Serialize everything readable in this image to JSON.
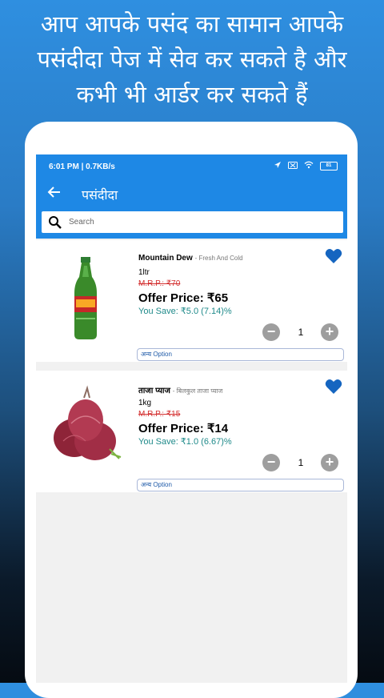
{
  "promo": {
    "line1": "आप आपके पसंद का सामान आपके",
    "line2": "पसंदीदा पेज में सेव कर सकते है और",
    "line3": "कभी भी आर्डर कर सकते हैं"
  },
  "statusbar": {
    "time": "6:01 PM | 0.7KB/s",
    "battery": "81"
  },
  "toolbar": {
    "title": "पसंदीदा"
  },
  "search": {
    "placeholder": "Search"
  },
  "products": [
    {
      "name": "Mountain Dew",
      "subtitle": "- Fresh And Cold",
      "unit": "1ltr",
      "mrp": "M.R.P.: ₹70",
      "offer": "Offer Price: ₹65",
      "save": "You Save: ₹5.0 (7.14)%",
      "quantity": "1",
      "option_label": "अन्य Option"
    },
    {
      "name": "ताजा प्याज",
      "subtitle": "- बिलकुल ताजा प्याज",
      "unit": "1kg",
      "mrp": "M.R.P.: ₹15",
      "offer": "Offer Price: ₹14",
      "save": "You Save: ₹1.0 (6.67)%",
      "quantity": "1",
      "option_label": "अन्य Option"
    }
  ],
  "colors": {
    "primary": "#1e88e5",
    "mrp": "#d32f2f",
    "save": "#1f8a8a",
    "heart": "#1565c0"
  },
  "icons": {
    "back": "arrow-back-icon",
    "search": "search-icon",
    "favorite": "heart-icon",
    "minus": "minus-icon",
    "plus": "plus-icon"
  }
}
